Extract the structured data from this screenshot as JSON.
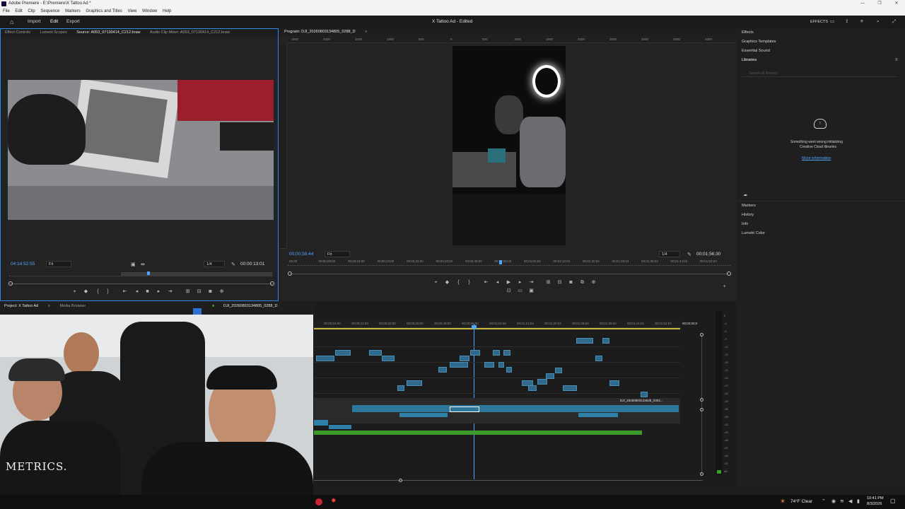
{
  "window": {
    "title": "Adobe Premiere - E:\\Premiere\\X Tattoo Ad *",
    "controls": [
      "—",
      "❐",
      "✕"
    ]
  },
  "menu": [
    "File",
    "Edit",
    "Clip",
    "Sequence",
    "Markers",
    "Graphics and Titles",
    "View",
    "Window",
    "Help"
  ],
  "header": {
    "tabs": [
      "Import",
      "Edit",
      "Export"
    ],
    "active_tab": "Edit",
    "project_title": "X Tattoo Ad - Edited",
    "effects_label": "EFFECTS"
  },
  "source_panel": {
    "tabs": [
      "Effect Controls",
      "Lumetri Scopes",
      "Source: A053_07130414_C212.braw",
      "Audio Clip Mixer: A053_07130414_C212.braw"
    ],
    "timecode_in": "04:14:52:55",
    "fit": "Fit",
    "resolution": "1/4",
    "duration": "00:00:13:01"
  },
  "program_panel": {
    "title": "Program: DJI_20260803134805_0288_D",
    "ruler_ticks": [
      "2500",
      "2000",
      "1500",
      "1000",
      "500",
      "0",
      "500",
      "1000",
      "1500",
      "2000",
      "2500",
      "3000",
      "3500",
      "4000"
    ],
    "timecode_in": "00;00;56;44",
    "fit": "Fit",
    "resolution": "1/4",
    "duration": "00;01;56;30",
    "scrub_ticks": [
      "00;00",
      "00;00;08;00",
      "00;00;16;00",
      "00;00;24;00",
      "00;00;32;00",
      "00;00;40;00",
      "00;00;48;00",
      "00;00;56;00",
      "00;01;04;04",
      "00;01;12;04",
      "00;01;20;04",
      "00;01;28;04",
      "00;01;36;04",
      "00;01;44;04",
      "00;01;52;04"
    ]
  },
  "right_panel": {
    "items_top": [
      "Effects",
      "Graphics Templates",
      "Essential Sound",
      "Libraries"
    ],
    "search_placeholder": "Search all libraries",
    "error_line1": "Something went wrong initializing",
    "error_line2": "Creative Cloud libraries",
    "more_info": "More information",
    "items_bottom": [
      "Markers",
      "History",
      "Info",
      "Lumetri Color"
    ]
  },
  "project_panel": {
    "tabs": [
      "Project: X Tattoo Ad",
      "Media Browser"
    ]
  },
  "webcam": {
    "shirt_text": "METRICS."
  },
  "timeline": {
    "sequence_tab": "DJI_20260803134805_0288_D",
    "ruler_ticks": [
      "00;00;16;00",
      "00;00;24;00",
      "00;00;32;00",
      "00;00;40;00",
      "00;00;48;00",
      "00;00;56;00",
      "00;01;04;04",
      "00;01;12;04",
      "00;01;20;04",
      "00;01;28;04",
      "00;01;36;04",
      "00;01;44;04",
      "00;01;52;04",
      "00;02;00;0"
    ],
    "clip_label": "DJI_20260803133539_0304..."
  },
  "audio_meter": {
    "scale": [
      "0",
      "-3",
      "-6",
      "-9",
      "-12",
      "-15",
      "-18",
      "-21",
      "-24",
      "-27",
      "-30",
      "-33",
      "-36",
      "-39",
      "-42",
      "-45",
      "-48",
      "-51",
      "-54",
      "-57",
      "dB"
    ]
  },
  "taskbar": {
    "weather": "74°F  Clear",
    "time": "10:41 PM",
    "date": "8/3/2026"
  },
  "colors": {
    "accent_blue": "#2d8ceb",
    "timecode_blue": "#4fa6ff",
    "clip_blue": "#2f6a8c",
    "audio_green": "#3d9a2a",
    "ring_light": "#ffffff"
  }
}
